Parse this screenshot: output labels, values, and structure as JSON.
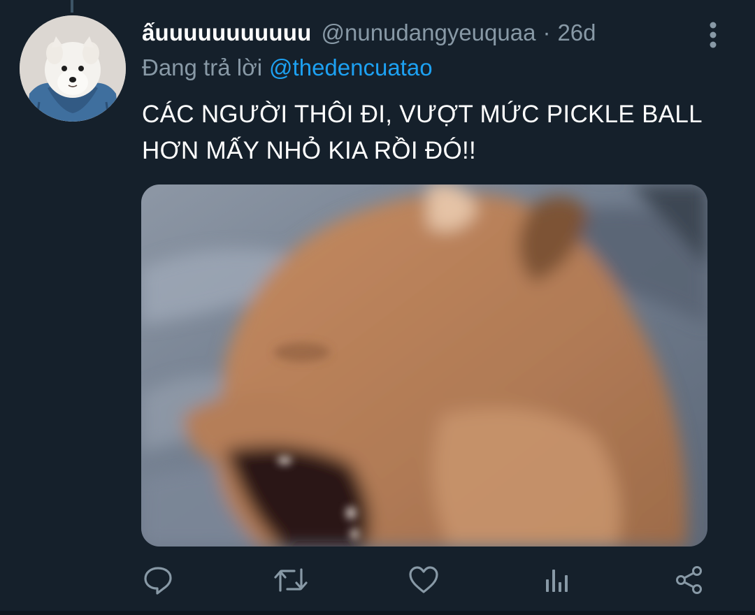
{
  "tweet": {
    "display_name": "ấuuuuuuuuuuu",
    "handle": "@nunudangyeuquaa",
    "separator": "·",
    "time": "26d",
    "replying_label": "Đang trả lời",
    "replying_to": "@thedencuatao",
    "text_line1": "CÁC NGƯỜI THÔI ĐI, VƯỢT MỨC PICKLE BALL",
    "text_line2": "HƠN MẤY NHỎ KIA RỒI ĐÓ!!"
  },
  "icons": {
    "more": "more-vertical-icon",
    "reply": "reply-icon",
    "retweet": "retweet-icon",
    "like": "heart-icon",
    "analytics": "analytics-icon",
    "share": "share-icon"
  },
  "colors": {
    "background": "#15202b",
    "text_primary": "#ffffff",
    "text_secondary": "#8899a6",
    "link": "#1da1f2",
    "thread_line": "#3d5466"
  }
}
